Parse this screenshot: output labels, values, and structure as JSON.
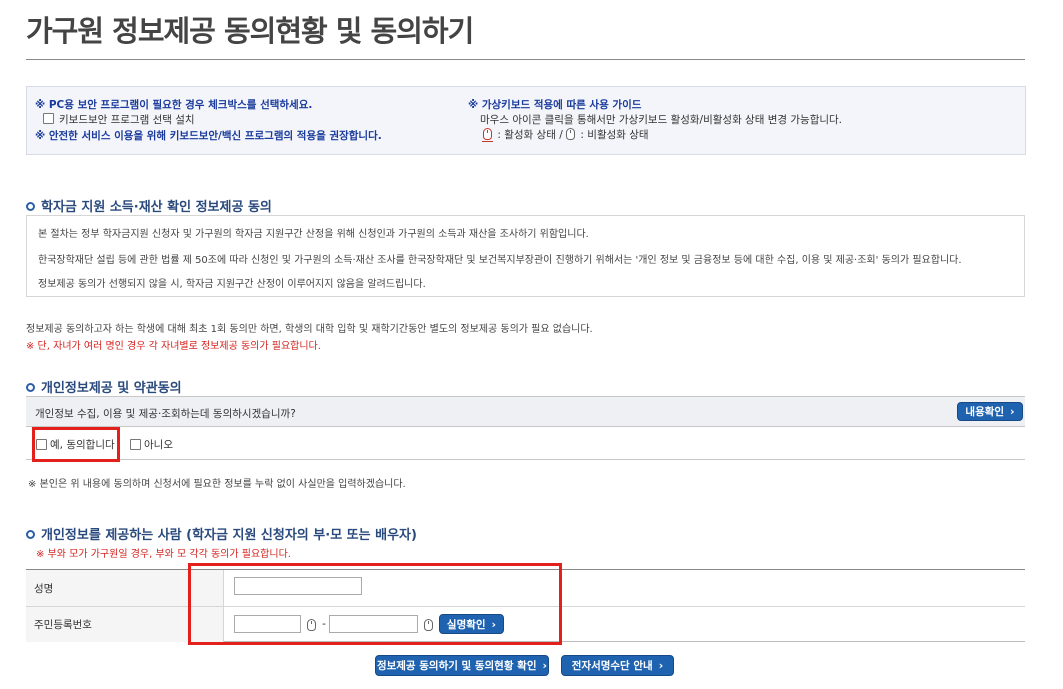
{
  "page": {
    "title": "가구원 정보제공 동의현황 및 동의하기"
  },
  "security": {
    "note1": "※ PC용 보안 프로그램이 필요한 경우 체크박스를 선택하세요.",
    "checkbox_label": "키보드보안 프로그램 선택 설치",
    "note2": "※ 안전한 서비스 이용을 위해 키보드보안/백신 프로그램의 적용을 권장합니다.",
    "vk_title": "※ 가상키보드 적용에 따른 사용 가이드",
    "vk_desc": "마우스 아이콘 클릭을 통해서만 가상키보드 활성화/비활성화 상태 변경 가능합니다.",
    "vk_active": ": 활성화 상태 /",
    "vk_inactive": ": 비활성화 상태"
  },
  "section1": {
    "title": "학자금 지원 소득·재산 확인 정보제공 동의",
    "lines": [
      "본 절차는 정부 학자금지원 신청자 및 가구원의 학자금 지원구간 산정을 위해 신청인과 가구원의 소득과 재산을 조사하기 위함입니다.",
      "한국장학재단 설립 등에 관한 법률 제 50조에 따라 신청인 및 가구원의 소득·재산 조사를 한국장학재단 및 보건복지부장관이 진행하기 위해서는 '개인 정보 및 금융정보 등에 대한 수집, 이용 및 제공·조회' 동의가 필요합니다.",
      "정보제공 동의가 선행되지 않을 시, 학자금 지원구간 산정이 이루어지지 않음을 알려드립니다."
    ],
    "after_note": "정보제공 동의하고자 하는 학생에 대해 최초 1회 동의만 하면, 학생의 대학 입학 및 재학기간동안 별도의 정보제공 동의가 필요 없습니다.",
    "after_warning": "※ 단, 자녀가 여러 명인 경우 각 자녀별로 정보제공 동의가 필요합니다."
  },
  "section2": {
    "title": "개인정보제공 및 약관동의",
    "question": "개인정보 수집, 이용 및 제공·조회하는데 동의하시겠습니까?",
    "view_button": "내용확인",
    "agree_label": "예, 동의합니다",
    "disagree_label": "아니오",
    "footnote": "※ 본인은 위 내용에 동의하며 신청서에 필요한 정보를 누락 없이 사실만을 입력하겠습니다."
  },
  "section3": {
    "title": "개인정보를 제공하는 사람 (학자금 지원 신청자의 부·모 또는 배우자)",
    "warning": "※ 부와 모가 가구원일 경우, 부와 모 각각 동의가 필요합니다.",
    "name_label": "성명",
    "name_value": "",
    "rrn_label": "주민등록번호",
    "rrn_front": "",
    "rrn_back": "",
    "rrn_dash": "-",
    "verify_button": "실명확인"
  },
  "actions": {
    "consent_button": "정보제공 동의하기 및 동의현황 확인",
    "esign_button": "전자서명수단 안내"
  },
  "colors": {
    "accent_blue": "#1f63b0",
    "highlight_red": "#e3201c",
    "note_blue": "#1a3b9c"
  }
}
